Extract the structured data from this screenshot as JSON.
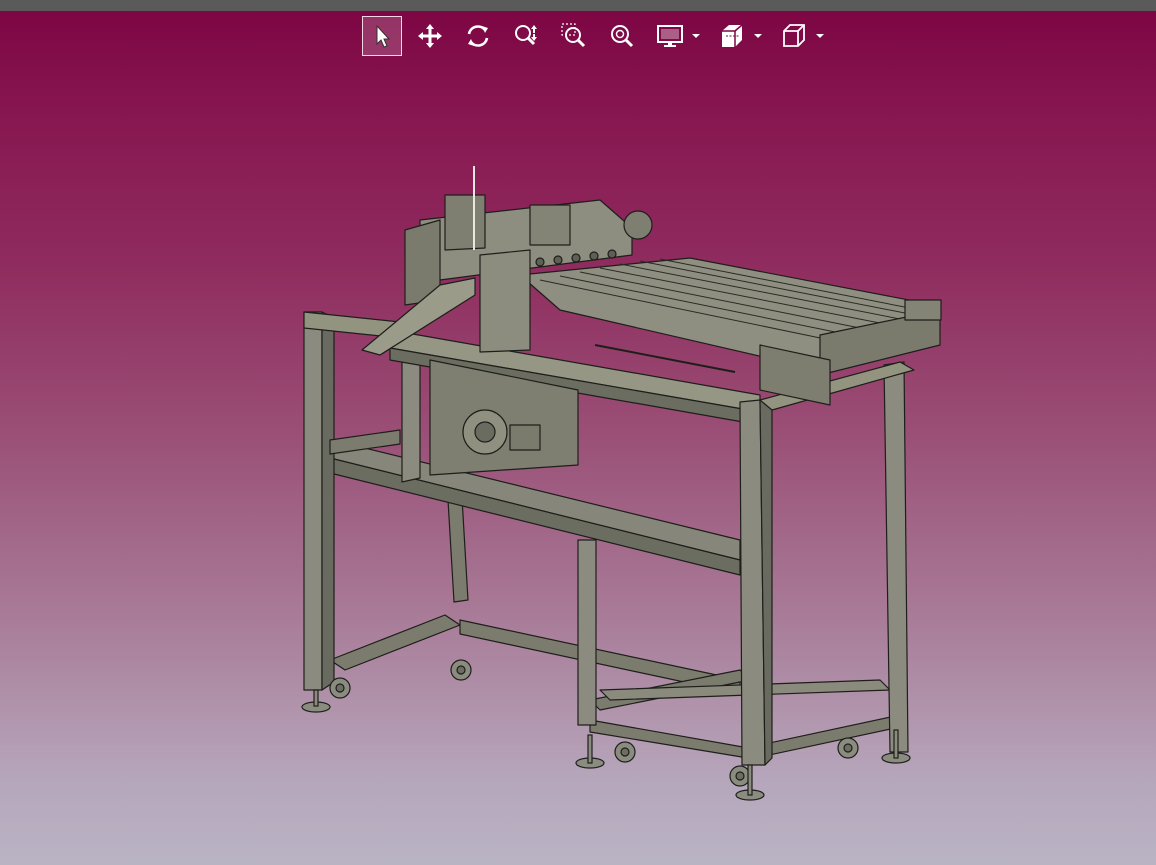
{
  "window": {
    "title": ""
  },
  "toolbar": {
    "tools": [
      {
        "id": "select",
        "icon": "cursor-arrow-icon",
        "active": true
      },
      {
        "id": "pan",
        "icon": "move-arrows-icon",
        "active": false
      },
      {
        "id": "rotate",
        "icon": "rotate-icon",
        "active": false
      },
      {
        "id": "zoom",
        "icon": "zoom-icon",
        "active": false
      },
      {
        "id": "zoom-window",
        "icon": "zoom-window-icon",
        "active": false
      },
      {
        "id": "zoom-fit",
        "icon": "zoom-fit-icon",
        "active": false
      },
      {
        "id": "display-mode",
        "icon": "monitor-icon",
        "active": false,
        "dropdown": true
      },
      {
        "id": "section-view",
        "icon": "section-cube-icon",
        "active": false,
        "dropdown": true
      },
      {
        "id": "standard-views",
        "icon": "cube-view-icon",
        "active": false,
        "dropdown": true
      }
    ]
  },
  "viewport": {
    "background_top": "#7c0442",
    "background_bottom": "#b9b4c4",
    "model": {
      "subject": "cnc-gantry-machine-on-wheeled-frame",
      "fill": "#7b7c6e",
      "edges": "#1e1e1a"
    }
  },
  "colors": {
    "topbar": "#5a5a5a",
    "active_tool": "#f0d8e4"
  }
}
